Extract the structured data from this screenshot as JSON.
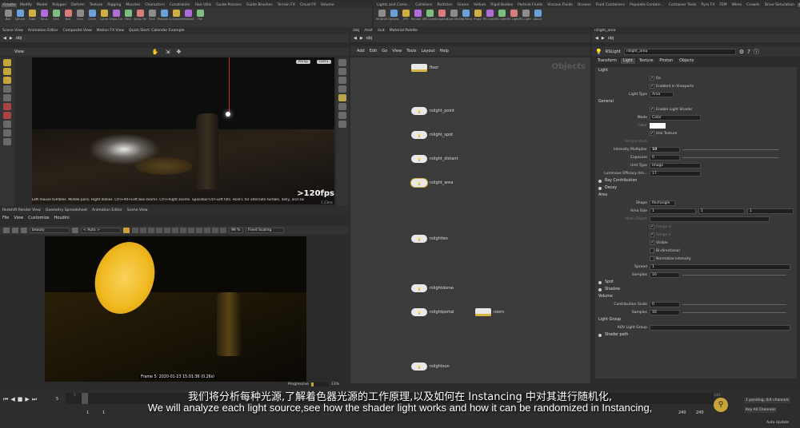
{
  "top_shelf_tabs_left": [
    "Create",
    "Modify",
    "Model",
    "Polygon",
    "Deform",
    "Texture",
    "Rigging",
    "Muscles",
    "Characters",
    "Constraints",
    "Hair Utils",
    "Guide Process",
    "Guide Brushes",
    "Terrain FX",
    "Cloud FX",
    "Volume"
  ],
  "top_shelf_tabs_right": [
    "Lights and Came...",
    "Collisions",
    "Particles",
    "Grains",
    "Vellum",
    "Rigid Bodies",
    "Particle Fluids",
    "Viscous Fluids",
    "Oceans",
    "Fluid Containers",
    "Populate Contain...",
    "Container Tools",
    "Pyro FX",
    "FEM",
    "Wires",
    "Crowds",
    "Drive Simulation",
    "Redshift",
    "Scripts"
  ],
  "left_tools": [
    "Box",
    "Sphere",
    "Tube",
    "Torus",
    "Grid",
    "Null",
    "Line",
    "Circle",
    "Curve",
    "Draw Curve",
    "Path",
    "Spray Paint",
    "Font",
    "Platonic Solids",
    "L-System",
    "Metaball",
    "File"
  ],
  "right_tools": [
    "Redshift",
    "Options",
    "IPR",
    "Render View",
    "RS Light",
    "Snapshot",
    "Cam Params",
    "Obj Params",
    "Proxy",
    "RS Light Dome",
    "RS Light IES",
    "RS Light Sun",
    "RS Light Portal",
    "About"
  ],
  "scene_tabs": [
    "Scene View",
    "Animation Editor",
    "Composite View",
    "Motion FX View",
    "Quick Start: Calendar Example"
  ],
  "scene_path": "obj",
  "view_label": "View",
  "viewport_persp": "Persp",
  "viewport_cam": "cam1",
  "fps": ">120fps",
  "fps_sub": "1.23ms",
  "viewport_hint": "Left mouse tumbles. Middle pans. Right dollies. Ctrl+Alt+Left box-zooms. Ctrl+Right zooms. Spacebar-Ctrl-Left tilts. Hold L for alternate tumble, dolly, and zoom.",
  "render_tabs": [
    "Redshift Render View",
    "Geometry Spreadsheet",
    "Animation Editor",
    "Scene View"
  ],
  "render_menu": [
    "File",
    "View",
    "Customize",
    "Houdini"
  ],
  "render_aov": "beauty",
  "render_auto": "< Auto >",
  "render_zoom": "98 %",
  "render_scaling": "Fixed Scaling",
  "frame_info": "Frame  5:  2020-01-23  15:01:36  (0.26s)",
  "progressive": "Progressive",
  "progressive_pct": "13%",
  "network_tabs": [
    "/obj",
    "/mat",
    "/out",
    "Material Palette"
  ],
  "network_path": "obj",
  "network_menu": [
    "Add",
    "Edit",
    "Go",
    "View",
    "Tools",
    "Layout",
    "Help"
  ],
  "network_watermark": "Objects",
  "nodes": [
    {
      "name": "floor",
      "label": "floor"
    },
    {
      "name": "rslight_point",
      "label": "rslight_point"
    },
    {
      "name": "rslight_spot",
      "label": "rslight_spot"
    },
    {
      "name": "rslight_distant",
      "label": "rslight_distant"
    },
    {
      "name": "rslight_area",
      "label": "rslight_area"
    },
    {
      "name": "rslighties",
      "label": "rslighties"
    },
    {
      "name": "rslightdome",
      "label": "rslightdome"
    },
    {
      "name": "rslightportal",
      "label": "rslightportal"
    },
    {
      "name": "room",
      "label": "room"
    },
    {
      "name": "rslightsun",
      "label": "rslightsun"
    }
  ],
  "param_tabs_top": [
    "rslight_area"
  ],
  "param_path": "obj",
  "param_node_type": "RSLight",
  "param_node_name": "rslight_area",
  "param_tabs": [
    "Transform",
    "Light",
    "Texture",
    "Photon",
    "Objects"
  ],
  "param": {
    "light_heading": "Light",
    "on": "On",
    "enabled_vp": "Enabled in Viewports",
    "light_type_label": "Light Type",
    "light_type": "Area",
    "general": "General",
    "enable_shader": "Enable Light Shader",
    "mode_label": "Mode",
    "mode": "Color",
    "color_label": "Color",
    "use_texture": "Use Texture",
    "temperature_label": "Temperature",
    "intensity_label": "Intensity Multiplier",
    "intensity": "10",
    "exposure_label": "Exposure",
    "exposure": "0",
    "unit_type_label": "Unit Type",
    "unit_type": "Image",
    "luminous_label": "Luminous Efficacy (lm...",
    "luminous": "17",
    "ray_contribution": "Ray Contribution",
    "decay": "Decay",
    "area_heading": "Area",
    "shape_label": "Shape",
    "shape": "Rectangle",
    "area_size_label": "Area Size",
    "area_size": [
      "1",
      "1",
      "1"
    ],
    "mesh_object_label": "Mesh Object",
    "range_u": "Range U",
    "range_v": "Range V",
    "visible": "Visible",
    "bidirectional": "Bi-directional",
    "normalize": "Normalize Intensity",
    "spread_label": "Spread",
    "spread": "1",
    "samples_label": "Samples",
    "samples": "16",
    "spot": "Spot",
    "shadow": "Shadow",
    "volume_heading": "Volume",
    "contrib_label": "Contribution Scale",
    "contrib": "0",
    "vol_samples_label": "Samples",
    "vol_samples": "16",
    "light_group": "Light Group",
    "aov_group_label": "AOV Light Group",
    "shader_path": "Shader path"
  },
  "timeline": {
    "current_frame": "5",
    "start": "1",
    "start2": "1",
    "ticks": [
      "5",
      "48",
      "96",
      "144",
      "192",
      "240"
    ],
    "end1": "240",
    "end2": "240",
    "keys_label": "1 pending, 0/4 channels",
    "channels_label": "Key All Channels",
    "auto_update": "Auto Update"
  },
  "subtitle_cn": "我们将分析每种光源,了解着色器光源的工作原理,以及如何在 Instancing 中对其进行随机化,",
  "subtitle_en": "We will analyze each light source,see how the shader light works and how it can be randomized in Instancing,"
}
